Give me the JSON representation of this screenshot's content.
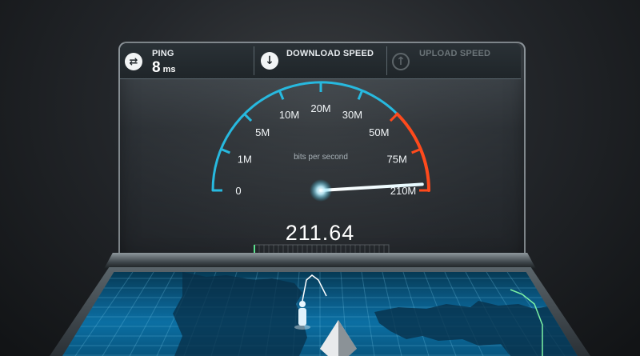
{
  "header": {
    "ping": {
      "label": "PING",
      "value": "8",
      "unit": "ms",
      "icon": "ping-exchange-icon"
    },
    "download": {
      "label": "DOWNLOAD SPEED",
      "icon": "download-arrow-icon"
    },
    "upload": {
      "label": "UPLOAD SPEED",
      "icon": "upload-arrow-icon"
    }
  },
  "gauge": {
    "unit_label": "bits per second",
    "reading": "211.64",
    "reading_value": 211.64,
    "tick_labels": [
      "0",
      "1M",
      "5M",
      "10M",
      "20M",
      "30M",
      "50M",
      "75M",
      "210M"
    ],
    "accent_color": "#27b9df",
    "alert_color": "#ff4a1c"
  },
  "console": {
    "server_marker": "server-pyramid-icon",
    "user_marker": "user-person-icon"
  }
}
